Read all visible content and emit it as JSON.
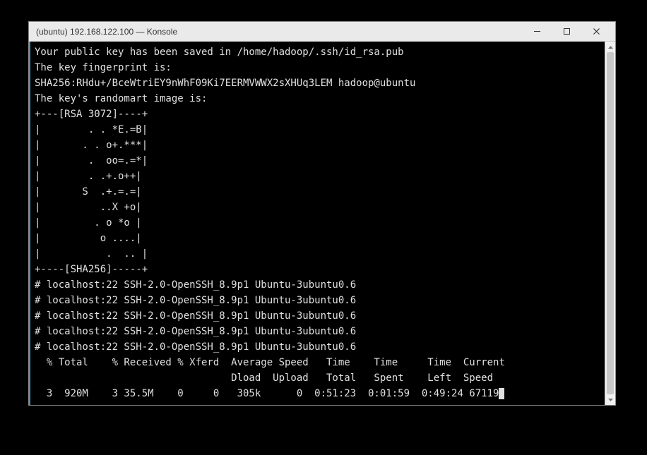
{
  "window": {
    "title": "(ubuntu) 192.168.122.100 — Konsole"
  },
  "terminal": {
    "lines": [
      "Your public key has been saved in /home/hadoop/.ssh/id_rsa.pub",
      "The key fingerprint is:",
      "SHA256:RHdu+/BceWtriEY9nWhF09Ki7EERMVWWX2sXHUq3LEM hadoop@ubuntu",
      "The key's randomart image is:",
      "+---[RSA 3072]----+",
      "|        . . *E.=B|",
      "|       . . o+.***|",
      "|        .  oo=.=*|",
      "|        . .+.o++|",
      "|       S  .+.=.=|",
      "|          ..X +o|",
      "|         . o *o |",
      "|          o ....|",
      "|           .  .. |",
      "+----[SHA256]-----+",
      "# localhost:22 SSH-2.0-OpenSSH_8.9p1 Ubuntu-3ubuntu0.6",
      "# localhost:22 SSH-2.0-OpenSSH_8.9p1 Ubuntu-3ubuntu0.6",
      "# localhost:22 SSH-2.0-OpenSSH_8.9p1 Ubuntu-3ubuntu0.6",
      "# localhost:22 SSH-2.0-OpenSSH_8.9p1 Ubuntu-3ubuntu0.6",
      "# localhost:22 SSH-2.0-OpenSSH_8.9p1 Ubuntu-3ubuntu0.6",
      "  % Total    % Received % Xferd  Average Speed   Time    Time     Time  Current",
      "                                 Dload  Upload   Total   Spent    Left  Speed",
      "  3  920M    3 35.5M    0     0   305k      0  0:51:23  0:01:59  0:49:24 67119"
    ]
  }
}
